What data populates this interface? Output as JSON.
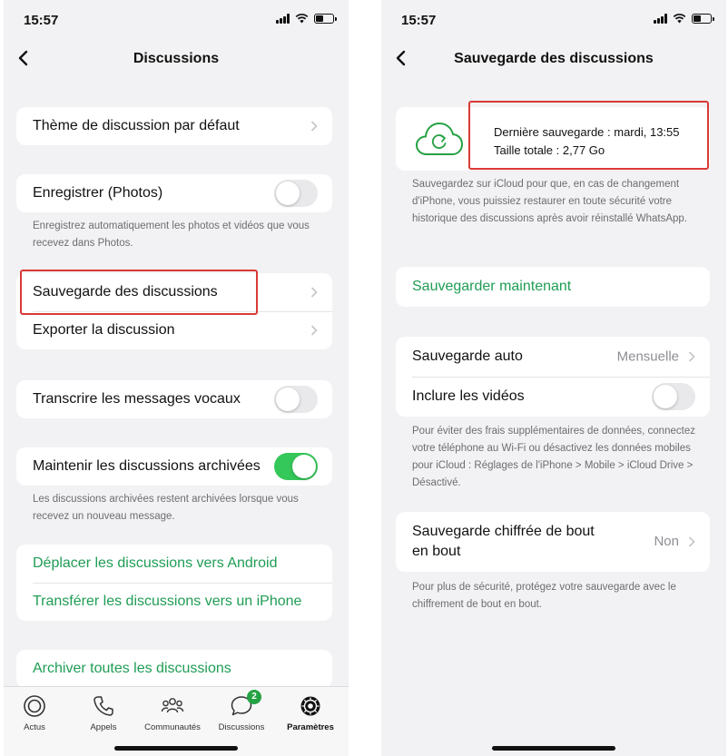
{
  "left": {
    "status": {
      "time": "15:57"
    },
    "nav": {
      "title": "Discussions"
    },
    "groups": {
      "theme": "Thème de discussion par défaut",
      "save_photos": "Enregistrer (Photos)",
      "save_photos_note": "Enregistrez automatiquement les photos et vidéos que vous recevez dans Photos.",
      "backup": "Sauvegarde des discussions",
      "export": "Exporter la discussion",
      "transcribe": "Transcrire les messages vocaux",
      "keep_archived": "Maintenir les discussions archivées",
      "keep_archived_note": "Les discussions archivées restent archivées lorsque vous recevez un nouveau message.",
      "move_android": "Déplacer les discussions vers Android",
      "transfer_iphone": "Transférer les discussions vers un iPhone",
      "archive_all": "Archiver toutes les discussions"
    },
    "toggles": {
      "save_photos": false,
      "transcribe": false,
      "keep_archived": true
    },
    "tabbar": [
      {
        "label": "Actus",
        "icon": "updates-icon"
      },
      {
        "label": "Appels",
        "icon": "phone-icon"
      },
      {
        "label": "Communautés",
        "icon": "communities-icon"
      },
      {
        "label": "Discussions",
        "icon": "chat-bubble-icon",
        "badge": "2"
      },
      {
        "label": "Paramètres",
        "icon": "settings-gear-icon",
        "active": true
      }
    ]
  },
  "right": {
    "status": {
      "time": "15:57"
    },
    "nav": {
      "title": "Sauvegarde des discussions"
    },
    "backup": {
      "last": "Dernière sauvegarde : mardi, 13:55",
      "size": "Taille totale : 2,77 Go",
      "note": "Sauvegardez sur iCloud pour que, en cas de changement d'iPhone, vous puissiez restaurer en toute sécurité votre historique des discussions après avoir réinstallé WhatsApp."
    },
    "backup_now": "Sauvegarder maintenant",
    "auto_backup": {
      "label": "Sauvegarde auto",
      "value": "Mensuelle"
    },
    "include_videos": {
      "label": "Inclure les vidéos",
      "on": false
    },
    "data_note": "Pour éviter des frais supplémentaires de données, connectez votre téléphone au Wi-Fi ou désactivez les données mobiles pour iCloud : Réglages de l'iPhone > Mobile > iCloud Drive > Désactivé.",
    "encrypted": {
      "label_line1": "Sauvegarde chiffrée de bout",
      "label_line2": "en bout",
      "value": "Non"
    },
    "encrypted_note": "Pour plus de sécurité, protégez votre sauvegarde avec le chiffrement de bout en bout."
  },
  "colors": {
    "accent_green": "#1f9d55",
    "toggle_on": "#34c759",
    "highlight_red": "#d93a36"
  }
}
